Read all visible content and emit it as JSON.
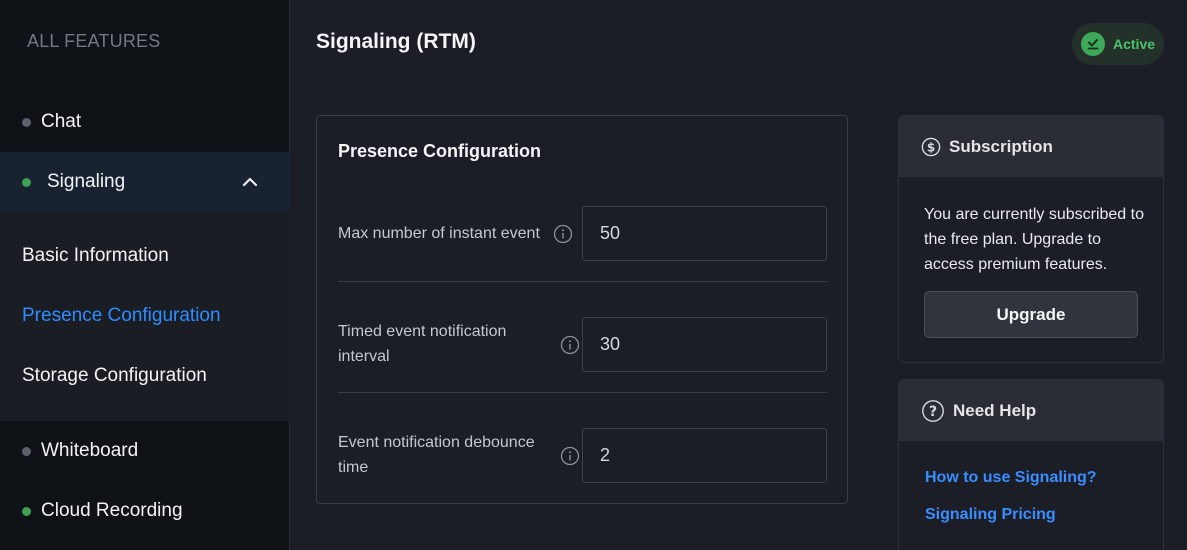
{
  "sidebar": {
    "heading": "ALL FEATURES",
    "items": [
      {
        "label": "Chat",
        "status": "inactive"
      },
      {
        "label": "Signaling",
        "status": "active",
        "expanded": true
      },
      {
        "label": "Whiteboard",
        "status": "inactive"
      },
      {
        "label": "Cloud Recording",
        "status": "active"
      }
    ],
    "submenu": [
      {
        "label": "Basic Information"
      },
      {
        "label": "Presence Configuration",
        "active": true
      },
      {
        "label": "Storage Configuration"
      }
    ]
  },
  "header": {
    "title": "Signaling (RTM)",
    "status": "Active"
  },
  "presence": {
    "title": "Presence Configuration",
    "fields": [
      {
        "label": "Max number of instant event",
        "value": "50"
      },
      {
        "label_line1": "Timed event notification",
        "label_line2": "interval",
        "value": "30"
      },
      {
        "label_line1": "Event notification debounce",
        "label_line2": "time",
        "value": "2"
      }
    ]
  },
  "subscription": {
    "title": "Subscription",
    "text": "You are currently subscribed to the free plan. Upgrade to access premium features.",
    "button": "Upgrade"
  },
  "help": {
    "title": "Need Help",
    "links": [
      "How to use Signaling?",
      "Signaling Pricing"
    ]
  },
  "colors": {
    "accent": "#2e8cff",
    "active_green": "#3fa85a",
    "background": "#1b1e26",
    "sidebar": "#0f1217"
  }
}
